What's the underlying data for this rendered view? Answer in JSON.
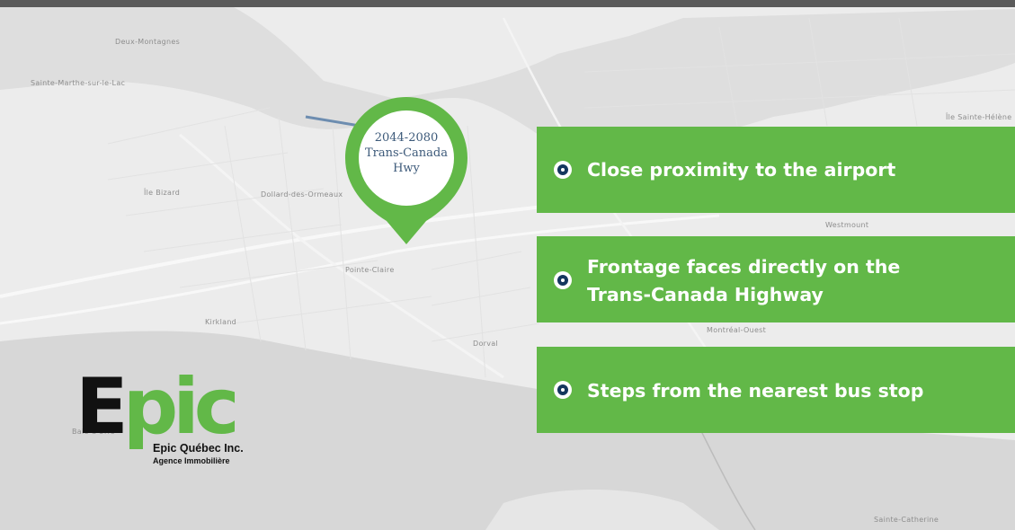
{
  "map": {
    "labels": [
      "Deux-Montagnes",
      "Sainte-Marthe-sur-le-Lac",
      "Île Bizard",
      "Dollard-des-Ormeaux",
      "Pointe-Claire",
      "Kirkland",
      "Dorval",
      "Westmount",
      "Montréal-Ouest",
      "Île Sainte-Hélène",
      "Sainte-Catherine",
      "Baie-d'Urfé"
    ]
  },
  "pin": {
    "line1": "2044-2080",
    "line2": "Trans-Canada",
    "line3": "Hwy"
  },
  "features": [
    {
      "text": "Close proximity to the airport"
    },
    {
      "text": "Frontage faces directly on the Trans-Canada Highway"
    },
    {
      "text": "Steps from the nearest bus stop"
    }
  ],
  "logo": {
    "word_main": "E",
    "word_accent": "pic",
    "company": "Epic Québec Inc.",
    "tagline": "Agence Immobilière"
  },
  "colors": {
    "accent_green": "#62b848",
    "bullet_navy": "#14375e",
    "pin_text": "#3d5a7a",
    "map_background": "#ececec"
  }
}
